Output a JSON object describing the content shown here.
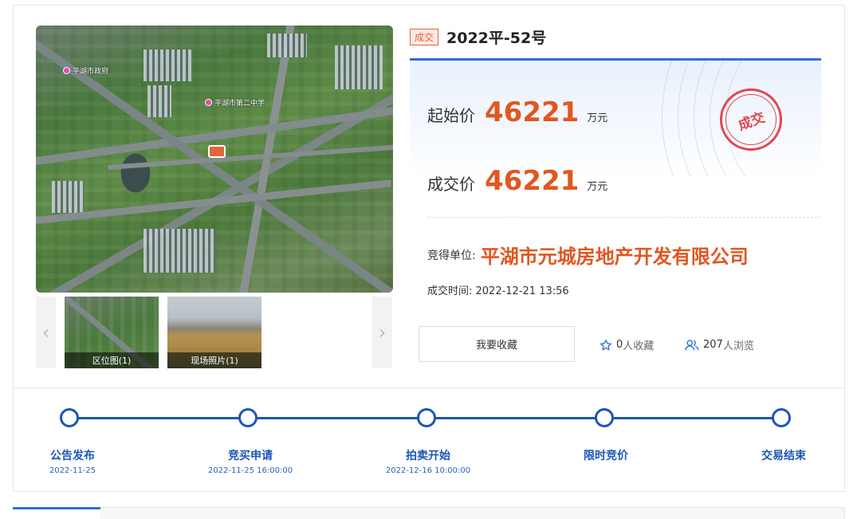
{
  "status_tag": "成交",
  "parcel_title": "2022平-52号",
  "map": {
    "labels": [
      "平湖市政府",
      "平湖市第二中学"
    ]
  },
  "thumbnails": [
    {
      "caption": "区位图(1)"
    },
    {
      "caption": "现场照片(1)"
    }
  ],
  "prices": {
    "start_label": "起始价",
    "start_value": "46221",
    "deal_label": "成交价",
    "deal_value": "46221",
    "unit": "万元"
  },
  "stamp_text": "成交",
  "winner": {
    "label": "竞得单位:",
    "value": "平湖市元城房地产开发有限公司"
  },
  "deal_time": "成交时间: 2022-12-21 13:56",
  "actions": {
    "favorite_button": "我要收藏",
    "favorites_count": "0",
    "favorites_suffix": "人收藏",
    "views_count": "207",
    "views_suffix": "人浏览"
  },
  "timeline": [
    {
      "name": "公告发布",
      "date": "2022-11-25"
    },
    {
      "name": "竞买申请",
      "date": "2022-11-25 16:00:00"
    },
    {
      "name": "拍卖开始",
      "date": "2022-12-16 10:00:00"
    },
    {
      "name": "限时竞价",
      "date": ""
    },
    {
      "name": "交易结束",
      "date": ""
    }
  ],
  "colors": {
    "accent_blue": "#1a56b8",
    "price_orange": "#e2561f",
    "stamp_red": "#e0464e"
  }
}
